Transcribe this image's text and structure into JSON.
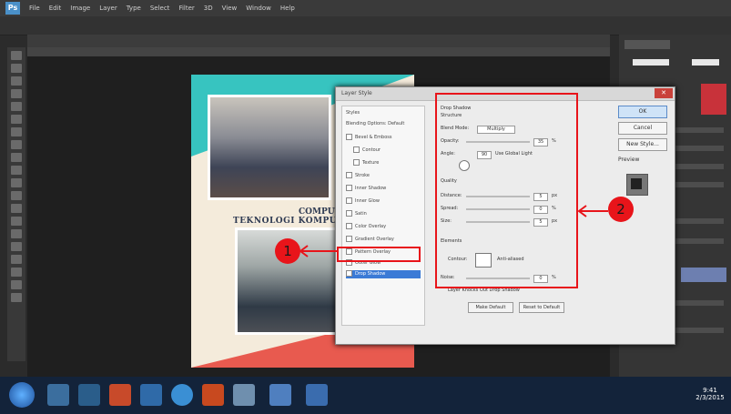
{
  "app": {
    "icon_text": "Ps"
  },
  "menu": [
    "File",
    "Edit",
    "Image",
    "Layer",
    "Type",
    "Select",
    "Filter",
    "3D",
    "View",
    "Window",
    "Help"
  ],
  "document": {
    "heading_line1": "COMPUTER",
    "heading_line2": "TEKNOLOGI KOMPUTER"
  },
  "dialog": {
    "title": "Layer Style",
    "close_symbol": "✕",
    "styles": [
      {
        "label": "Styles",
        "checked": false
      },
      {
        "label": "Blending Options: Default",
        "checked": false
      },
      {
        "label": "Bevel & Emboss",
        "checked": true
      },
      {
        "label": "Contour",
        "checked": false
      },
      {
        "label": "Texture",
        "checked": false
      },
      {
        "label": "Stroke",
        "checked": true
      },
      {
        "label": "Inner Shadow",
        "checked": true
      },
      {
        "label": "Inner Glow",
        "checked": true
      },
      {
        "label": "Satin",
        "checked": true
      },
      {
        "label": "Color Overlay",
        "checked": true
      },
      {
        "label": "Gradient Overlay",
        "checked": true
      },
      {
        "label": "Pattern Overlay",
        "checked": true
      },
      {
        "label": "Outer Glow",
        "checked": true
      },
      {
        "label": "Drop Shadow",
        "checked": true
      }
    ],
    "selected_style_index": 13,
    "content": {
      "header": "Drop Shadow",
      "subheader": "Structure",
      "blend_mode_label": "Blend Mode:",
      "blend_mode_value": "Multiply",
      "opacity_label": "Opacity:",
      "opacity_value": "35",
      "angle_label": "Angle:",
      "angle_value": "90",
      "global_light_label": "Use Global Light",
      "quality_label": "Quality",
      "distance_label": "Distance:",
      "distance_value": "5",
      "spread_label": "Spread:",
      "spread_value": "0",
      "size_label": "Size:",
      "size_value": "5",
      "elements_label": "Elements",
      "contour_label": "Contour:",
      "anti_aliased_label": "Anti-aliased",
      "noise_label": "Noise:",
      "noise_value": "0",
      "knockout_label": "Layer Knocks Out Drop Shadow",
      "unit_percent": "%",
      "unit_px": "px",
      "make_default_label": "Make Default",
      "reset_default_label": "Reset to Default"
    },
    "buttons": {
      "ok": "OK",
      "cancel": "Cancel",
      "new_style": "New Style...",
      "preview": "Preview"
    }
  },
  "annotations": {
    "marker_1": "1",
    "marker_2": "2",
    "color": "#e8141a"
  },
  "taskbar": {
    "clock_time": "9:41",
    "clock_date": "2/3/2015"
  }
}
